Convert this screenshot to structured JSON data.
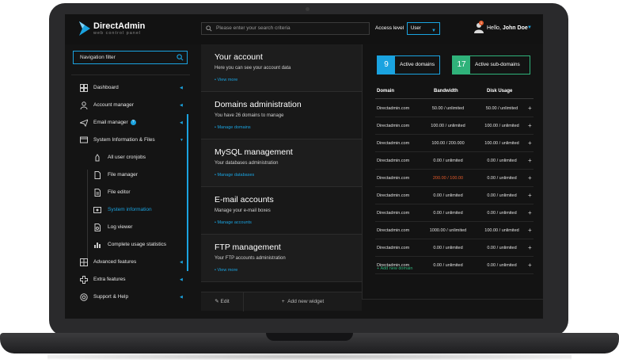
{
  "header": {
    "brand": "DirectAdmin",
    "brand_tagline": "web control panel",
    "search_placeholder": "Please enter your search criteria",
    "access_label": "Access level",
    "access_value": "User",
    "greeting": "Hello,",
    "user_name": "John Doe",
    "notification_count": "1"
  },
  "sidebar": {
    "filter_placeholder": "Navigation filter",
    "items": [
      {
        "label": "Dashboard",
        "icon": "dashboard-icon"
      },
      {
        "label": "Account manager",
        "icon": "account-icon"
      },
      {
        "label": "Email manager",
        "icon": "email-icon"
      },
      {
        "label": "System Information & Files",
        "icon": "system-icon"
      },
      {
        "label": "All user cronjobs",
        "icon": "cron-icon"
      },
      {
        "label": "File manager",
        "icon": "file-icon"
      },
      {
        "label": "File editor",
        "icon": "file-edit-icon"
      },
      {
        "label": "System information",
        "icon": "system-info-icon"
      },
      {
        "label": "Log viewer",
        "icon": "log-icon"
      },
      {
        "label": "Complete usage statistics",
        "icon": "stats-icon"
      },
      {
        "label": "Advanced features",
        "icon": "advanced-icon"
      },
      {
        "label": "Extra features",
        "icon": "extra-icon"
      },
      {
        "label": "Support & Help",
        "icon": "support-icon"
      }
    ]
  },
  "widgets": [
    {
      "title": "Your account",
      "subtitle": "Here you can see your account data",
      "link": "View more"
    },
    {
      "title": "Domains administration",
      "subtitle": "You have 26 domains to manage",
      "link": "Manage domains"
    },
    {
      "title": "MySQL management",
      "subtitle": "Your databases administration",
      "link": "Manage databases"
    },
    {
      "title": "E-mail accounts",
      "subtitle": "Manage your e-mail boxes",
      "link": "Manage accounts"
    },
    {
      "title": "FTP management",
      "subtitle": "Your FTP accounts administration",
      "link": "View more"
    }
  ],
  "widget_footer": {
    "edit": "Edit",
    "add": "Add new widget"
  },
  "domains": {
    "active_domains_count": "9",
    "active_domains_label": "Active domains",
    "active_subdomains_count": "17",
    "active_subdomains_label": "Active sub-domains",
    "columns": [
      "Domain",
      "Bandwidth",
      "Disk Usage"
    ],
    "rows": [
      [
        "Directadmin.com",
        "50.00 / unlimited",
        "50.00 / unlimited"
      ],
      [
        "Directadmin.com",
        "100.00 / unlimited",
        "100.00 / unlimited"
      ],
      [
        "Directadmin.com",
        "100.00 / 200.000",
        "100.00 / unlimited"
      ],
      [
        "Directadmin.com",
        "0.00 / unlimited",
        "0.00 / unlimited"
      ],
      [
        "Directadmin.com",
        "200.00 / 100.00",
        "0.00 / unlimited"
      ],
      [
        "Directadmin.com",
        "0.00 / unlimited",
        "0.00 / unlimited"
      ],
      [
        "Directadmin.com",
        "0.00 / unlimited",
        "0.00 / unlimited"
      ],
      [
        "Directadmin.com",
        "1000.00 / unlimited",
        "100.00 / unlimited"
      ],
      [
        "Directadmin.com",
        "0.00 / unlimited",
        "0.00 / unlimited"
      ],
      [
        "Directadmin.com",
        "0.00 / unlimited",
        "0.00 / unlimited"
      ]
    ],
    "warn_row": 4,
    "add_link": "Add new domain"
  },
  "colors": {
    "accent": "#1aa3e0",
    "success": "#2fb27a",
    "warning": "#e35a2a"
  }
}
